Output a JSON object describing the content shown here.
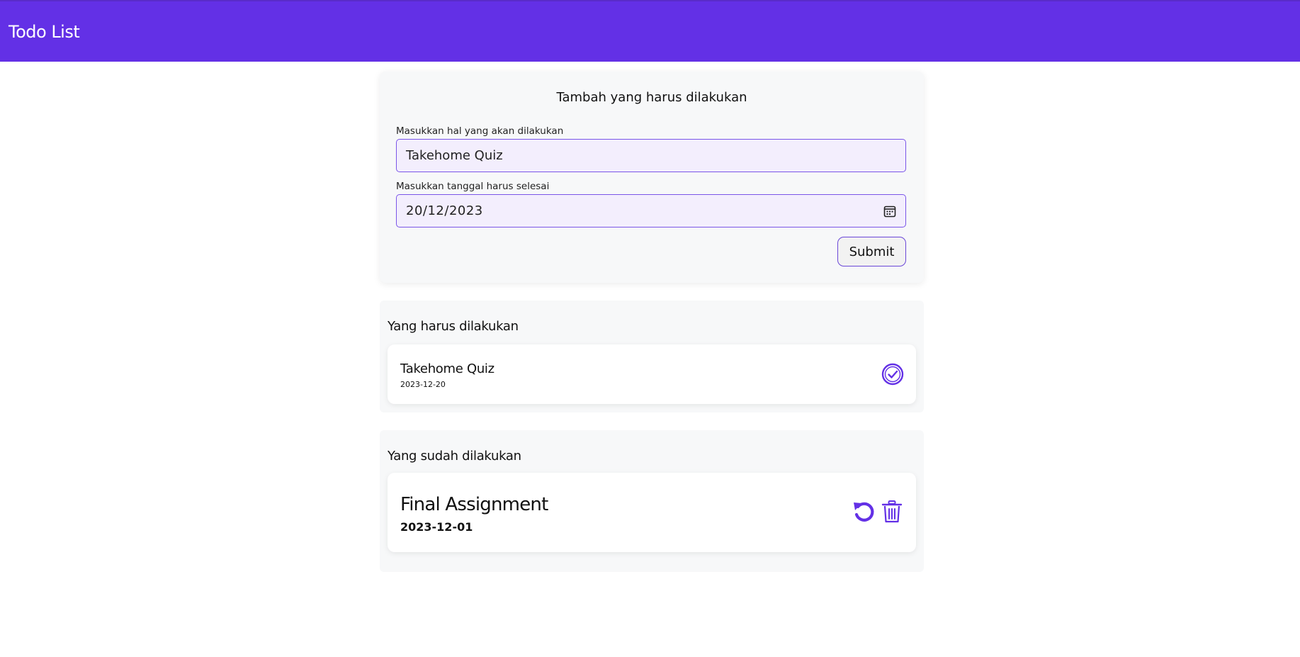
{
  "header": {
    "title": "Todo List"
  },
  "form": {
    "title": "Tambah yang harus dilakukan",
    "task_label": "Masukkan hal yang akan dilakukan",
    "task_value": "Takehome Quiz",
    "date_label": "Masukkan tanggal harus selesai",
    "date_value": "20/12/2023",
    "submit_label": "Submit"
  },
  "todo": {
    "title": "Yang harus dilakukan",
    "items": [
      {
        "title": "Takehome Quiz",
        "date": "2023-12-20"
      }
    ]
  },
  "done": {
    "title": "Yang sudah dilakukan",
    "items": [
      {
        "title": "Final Assignment",
        "date": "2023-12-01"
      }
    ]
  },
  "colors": {
    "accent": "#6330e6"
  },
  "icons": [
    "calendar-icon",
    "check-circle-icon",
    "undo-icon",
    "trash-icon"
  ]
}
